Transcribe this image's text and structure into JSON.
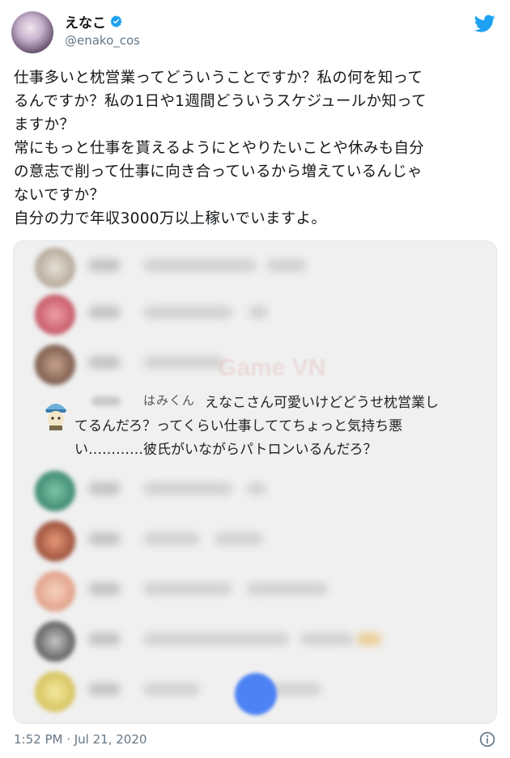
{
  "user": {
    "display_name": "えなこ",
    "handle": "@enako_cos"
  },
  "tweet": {
    "lines": [
      "仕事多いと枕営業ってどういうことですか？私の何を知って",
      "るんですか？私の1日や1週間どういうスケジュールか知って",
      "ますか？",
      "常にもっと仕事を貰えるようにとやりたいことや休みも自分",
      "の意志で削って仕事に向き合っているから増えているんじゃ",
      "ないですか？",
      "自分の力で年収3000万以上稼いでいますよ。"
    ],
    "timestamp": "1:52 PM · Jul 21, 2020"
  },
  "media": {
    "watermark": "Game VN",
    "highlight_user": "はみくん",
    "highlight_lines": [
      "えなこさん可愛いけどどうせ枕営業し",
      "てるんだろ？ってくらい仕事しててちょっと気持ち悪",
      "い…………彼氏がいながらパトロンいるんだろ？"
    ]
  },
  "colors": {
    "brand": "#1da1f2",
    "muted": "#657786",
    "fab": "#4c82f3"
  },
  "icons": [
    "verified-badge-icon",
    "twitter-bird-icon",
    "info-icon"
  ]
}
